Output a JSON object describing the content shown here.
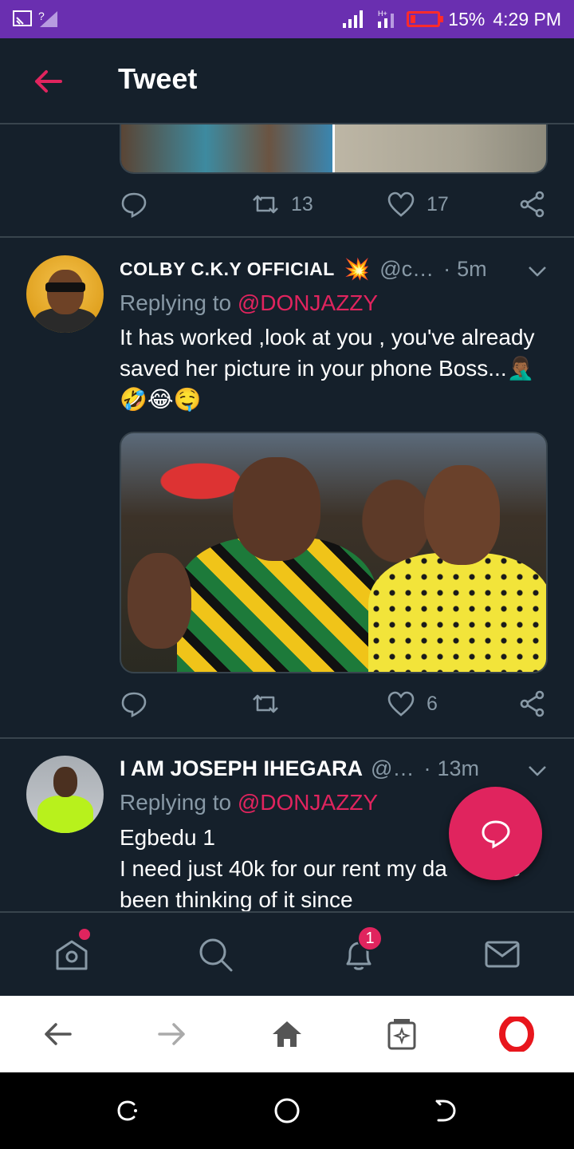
{
  "status_bar": {
    "battery": "15%",
    "battery_level": 0.15,
    "time": "4:29 PM"
  },
  "header": {
    "title": "Tweet"
  },
  "prev_tweet": {
    "retweets": "13",
    "likes": "17"
  },
  "tweets": [
    {
      "name": "COLBY C.K.Y OFFICIAL",
      "name_emoji": "💥",
      "handle": "@c…",
      "dot": "·",
      "time": "5m",
      "reply_prefix": "Replying to ",
      "reply_to": "@DONJAZZY",
      "text": "It has worked ,look at you , you've already saved her picture in your phone Boss...🤦🏾‍♂️🤣😂🤤",
      "retweets": "",
      "likes": "6"
    },
    {
      "name": "I AM JOSEPH IHEGARA",
      "handle": "@…",
      "dot": "·",
      "time": "13m",
      "reply_prefix": "Replying to ",
      "reply_to": "@DONJAZZY",
      "text_line1": "Egbedu 1",
      "text_line2": "I need just 40k for our rent my da        as been thinking of it since"
    }
  ],
  "tabbar": {
    "notifications_badge": "1"
  },
  "icons": {
    "back": "arrow-left-icon",
    "reply": "reply-icon",
    "retweet": "retweet-icon",
    "like": "heart-icon",
    "share": "share-icon",
    "compose": "compose-icon",
    "home": "home-icon",
    "search": "search-icon",
    "notifications": "bell-icon",
    "messages": "mail-icon"
  },
  "colors": {
    "accent": "#e0245e",
    "background": "#15202b",
    "muted": "#8899a6",
    "status_bar": "#6a2fb0"
  }
}
